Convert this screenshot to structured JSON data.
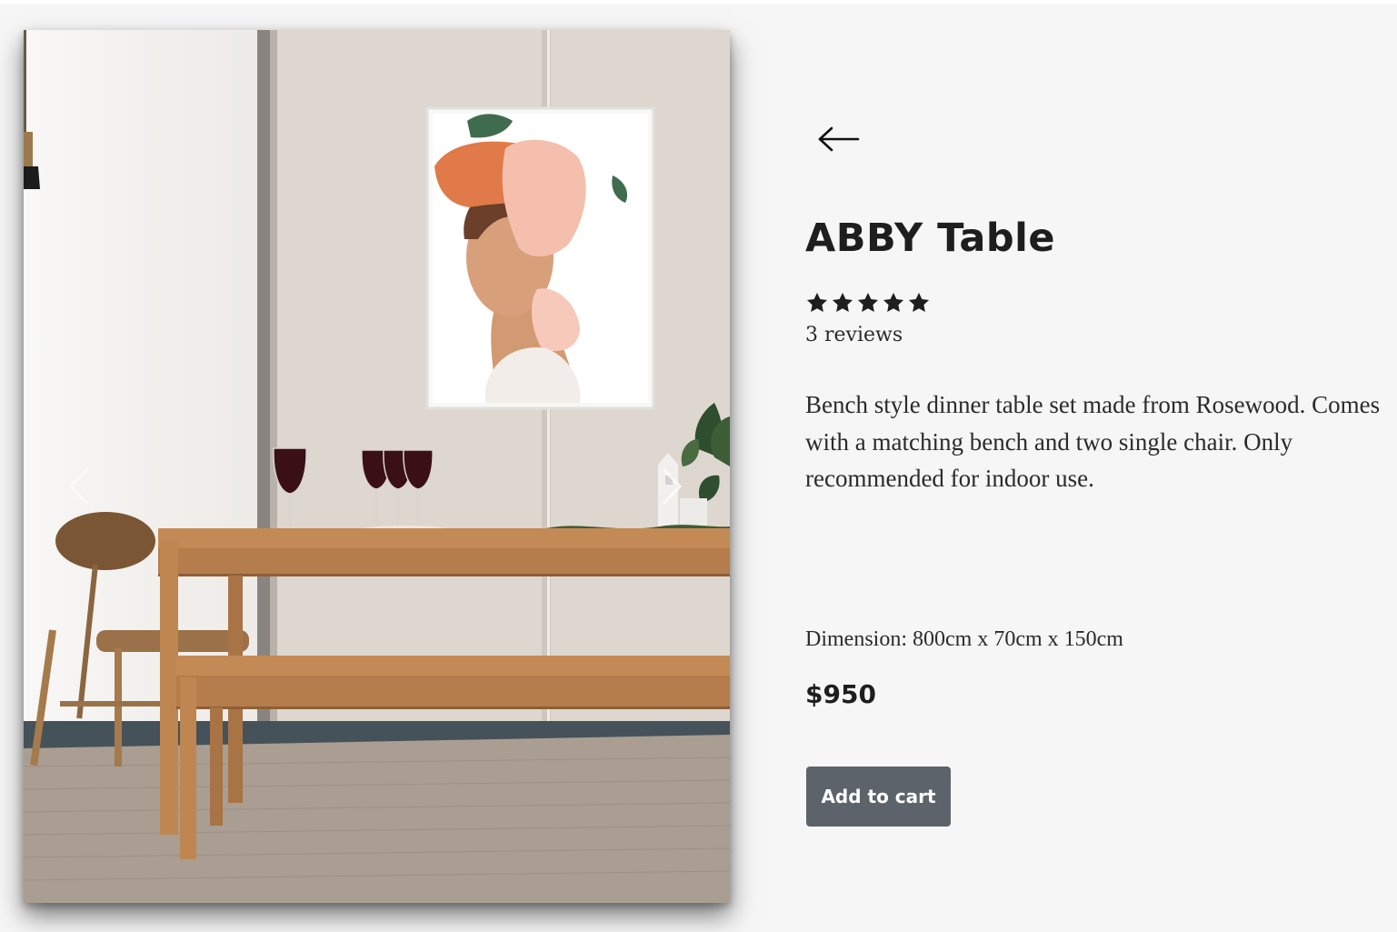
{
  "product": {
    "title": "ABBY Table",
    "rating": 5,
    "rating_max": 5,
    "reviews_label": "3 reviews",
    "description": "Bench style dinner table set made from Rosewood. Comes with a matching bench and two single chair. Only recommended for indoor use.",
    "dimension": "Dimension: 800cm x 70cm x 150cm",
    "price": "$950"
  },
  "actions": {
    "add_to_cart_label": "Add to cart"
  },
  "icons": {
    "back": "arrow-left-icon",
    "star": "star-icon",
    "carousel_prev": "chevron-left-icon",
    "carousel_next": "chevron-right-icon"
  },
  "colors": {
    "page_background": "#f6f6f6",
    "text": "#1e1e1e",
    "button_background": "#5c636a",
    "button_text": "#ffffff"
  }
}
